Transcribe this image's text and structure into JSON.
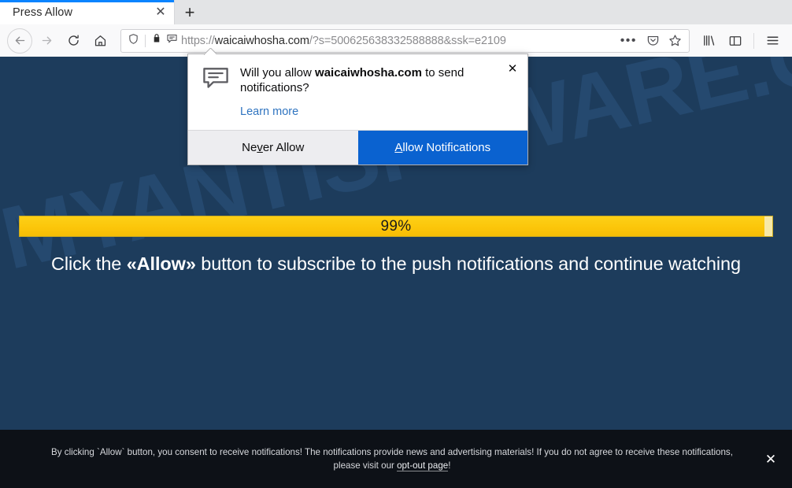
{
  "browser": {
    "tab": {
      "title": "Press Allow",
      "close_label": "✕",
      "newtab_label": "+"
    },
    "nav": {
      "back_icon": "back-arrow-icon",
      "forward_icon": "forward-arrow-icon",
      "reload_icon": "reload-icon",
      "home_icon": "home-icon"
    },
    "urlbar": {
      "scheme": "https://",
      "host": "waicaiwhosha.com",
      "path": "/?s=500625638332588888&ssk=e2109",
      "full_url": "https://waicaiwhosha.com/?s=500625638332588888&ssk=e2109",
      "tracking_icon": "shield-icon",
      "lock_icon": "padlock-icon",
      "notification_icon": "notification-permission-icon",
      "page_actions_label": "•••",
      "pocket_icon": "pocket-icon",
      "bookmark_icon": "star-icon"
    },
    "toolbar": {
      "library_icon": "library-icon",
      "sidebar_icon": "sidebar-icon",
      "menu_icon": "hamburger-menu-icon"
    }
  },
  "doorhanger": {
    "question_prefix": "Will you allow ",
    "question_host": "waicaiwhosha.com",
    "question_suffix": " to send notifications?",
    "learn_more": "Learn more",
    "close_label": "✕",
    "never_allow": {
      "pre": "Ne",
      "key": "v",
      "post": "er Allow"
    },
    "allow": {
      "key": "A",
      "post": "llow Notifications"
    },
    "primary_color": "#0a62d0"
  },
  "page": {
    "watermark": "MYANTISPYWARE.COM",
    "background_color": "#1d3c5c",
    "progress": {
      "percent": 99,
      "label": "99%",
      "fill_color": "#fcc60a",
      "track_color": "#f7e9a8"
    },
    "headline": {
      "before": "Click the ",
      "bold": "«Allow»",
      "after": " button to subscribe to the push notifications and continue watching"
    },
    "consent": {
      "line1": "By clicking `Allow` button, you consent to receive notifications! The notifications provide news and advertising materials! If you do not agree to receive these notifications,",
      "line2_before": "please visit our ",
      "line2_link": "opt-out page",
      "line2_after": "!",
      "close_label": "✕"
    }
  }
}
